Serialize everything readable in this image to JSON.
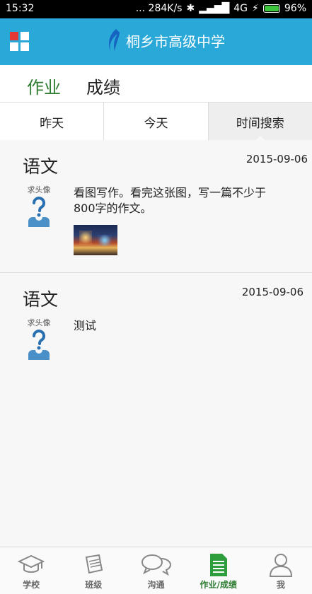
{
  "status_bar": {
    "time": "15:32",
    "indicators": "... 284K/s",
    "network": "4G",
    "battery": "96%"
  },
  "app_bar": {
    "title": "桐乡市高级中学",
    "menu_icon": "grid-menu-icon",
    "logo_icon": "school-logo-icon",
    "accent_color": "#2aa8d8"
  },
  "top_tabs": [
    {
      "label": "作业",
      "active": true
    },
    {
      "label": "成绩",
      "active": false
    }
  ],
  "date_tabs": [
    {
      "label": "昨天",
      "active": false
    },
    {
      "label": "今天",
      "active": false
    },
    {
      "label": "时间搜索",
      "active": true
    }
  ],
  "homework": [
    {
      "subject": "语文",
      "date": "2015-09-06",
      "avatar_text": "求头像",
      "content": "看图写作。看完这张图，写一篇不少于800字的作文。",
      "has_image": true
    },
    {
      "subject": "语文",
      "date": "2015-09-06",
      "avatar_text": "求头像",
      "content": "测试",
      "has_image": false
    }
  ],
  "bottom_nav": [
    {
      "label": "学校",
      "icon": "graduation-cap-icon",
      "active": false
    },
    {
      "label": "班级",
      "icon": "books-icon",
      "active": false
    },
    {
      "label": "沟通",
      "icon": "chat-bubbles-icon",
      "active": false
    },
    {
      "label": "作业/成绩",
      "icon": "document-icon",
      "active": true
    },
    {
      "label": "我",
      "icon": "person-icon",
      "active": false
    }
  ],
  "colors": {
    "active_green": "#2e7d32",
    "status_bar": "#000000"
  }
}
